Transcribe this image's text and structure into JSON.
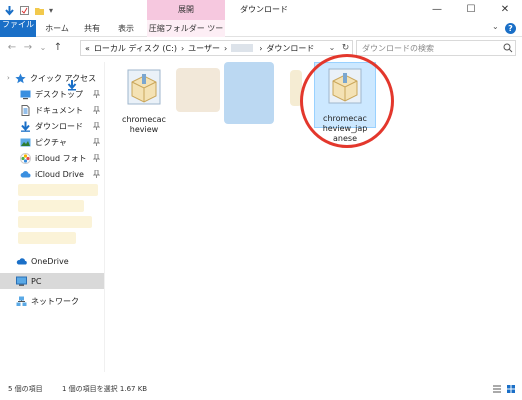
{
  "window": {
    "title": "ダウンロード",
    "tool_tab": "展開",
    "controls": {
      "minimize": "—",
      "maximize": "☐",
      "close": "✕"
    }
  },
  "ribbon": {
    "tabs": [
      {
        "label": "ファイル",
        "active": true
      },
      {
        "label": "ホーム"
      },
      {
        "label": "共有"
      },
      {
        "label": "表示"
      },
      {
        "label": "圧縮フォルダー ツール",
        "contextual": true
      }
    ],
    "help": "?"
  },
  "addressbar": {
    "back": "←",
    "forward": "→",
    "history": "⌄",
    "up": "↑",
    "breadcrumb": [
      "«",
      "ローカル ディスク (C:)",
      "›",
      "ユーザー",
      "›",
      "›",
      "ダウンロード"
    ],
    "dropdown": "⌄",
    "refresh": "↻",
    "search_placeholder": "ダウンロードの検索"
  },
  "sidebar": {
    "items": [
      {
        "label": "クイック アクセス",
        "icon": "star-icon",
        "pinned": false
      },
      {
        "label": "デスクトップ",
        "icon": "desktop-icon",
        "pinned": true
      },
      {
        "label": "ドキュメント",
        "icon": "document-icon",
        "pinned": true
      },
      {
        "label": "ダウンロード",
        "icon": "download-icon",
        "pinned": true
      },
      {
        "label": "ピクチャ",
        "icon": "pictures-icon",
        "pinned": true
      },
      {
        "label": "iCloud フォト",
        "icon": "icloud-photos-icon",
        "pinned": true
      },
      {
        "label": "iCloud Drive",
        "icon": "icloud-drive-icon",
        "pinned": true
      },
      {
        "label": "OneDrive",
        "icon": "onedrive-icon",
        "pinned": false
      },
      {
        "label": "PC",
        "icon": "pc-icon",
        "pinned": false,
        "selected": true
      },
      {
        "label": "ネットワーク",
        "icon": "network-icon",
        "pinned": false
      }
    ]
  },
  "files": [
    {
      "name": "chromecac\nheview",
      "icon": "zip-folder-icon"
    },
    {
      "name": "chromecac\nheview_jap\nanese",
      "icon": "zip-folder-icon",
      "selected": true
    }
  ],
  "status": {
    "count": "5 個の項目",
    "selection": "1 個の項目を選択  1.67 KB"
  },
  "colors": {
    "accent": "#1a6fc7",
    "tool_tab": "#f6c8df",
    "selection": "#cce8ff",
    "highlight_ring": "#e3372c"
  }
}
